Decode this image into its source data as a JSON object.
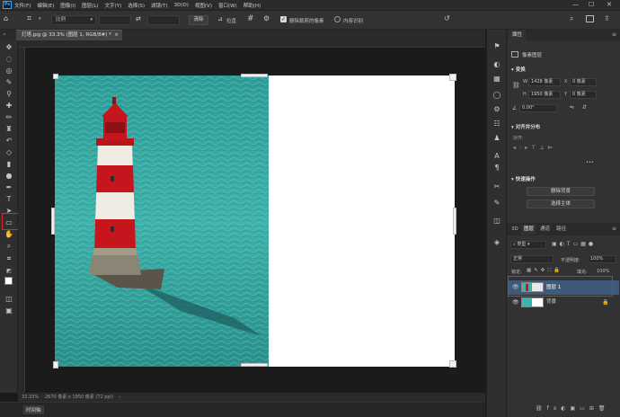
{
  "app": {
    "logo": "Ps"
  },
  "menu": [
    "文件(F)",
    "编辑(E)",
    "图像(I)",
    "图层(L)",
    "文字(Y)",
    "选择(S)",
    "滤镜(T)",
    "3D(D)",
    "视图(V)",
    "窗口(W)",
    "帮助(H)"
  ],
  "window_controls": {
    "minimize": "—",
    "maximize": "☐",
    "close": "✕"
  },
  "options": {
    "ratio_value": "比例",
    "clear_button": "清除",
    "straighten_label": "拉直",
    "delete_cropped_label": "删除裁剪的像素",
    "content_aware_label": "内容识别"
  },
  "document_tab": {
    "title": "灯塔.jpg @ 33.3% (图层 1, RGB/8#) *",
    "close": "×"
  },
  "status": {
    "zoom": "33.33%",
    "dims": "2670 像素 x 1950 像素 (72 ppi)",
    "arrow": "›"
  },
  "timeline": {
    "label": "时间轴"
  },
  "properties": {
    "tab": "属性",
    "pixel_layer": "像素图层",
    "transform_title": "变换",
    "w_label": "W",
    "w_value": "1428 像素",
    "h_label": "H",
    "h_value": "1950 像素",
    "x_label": "X",
    "x_value": "0 像素",
    "y_label": "Y",
    "y_value": "0 像素",
    "angle_value": "0.00°",
    "align_title": "对齐并分布",
    "align_sub": "对齐:",
    "more": "•••",
    "quick_title": "快速操作",
    "remove_bg": "删除背景",
    "select_subject": "选择主体"
  },
  "layers_panel": {
    "tabs": [
      "3D",
      "图层",
      "通道",
      "路径"
    ],
    "filter_kind": "类型",
    "blend_mode": "正常",
    "opacity_label": "不透明度:",
    "opacity_value": "100%",
    "lock_label": "锁定:",
    "fill_label": "填充:",
    "fill_value": "100%",
    "layers": [
      {
        "name": "图层 1"
      },
      {
        "name": "背景"
      }
    ]
  }
}
